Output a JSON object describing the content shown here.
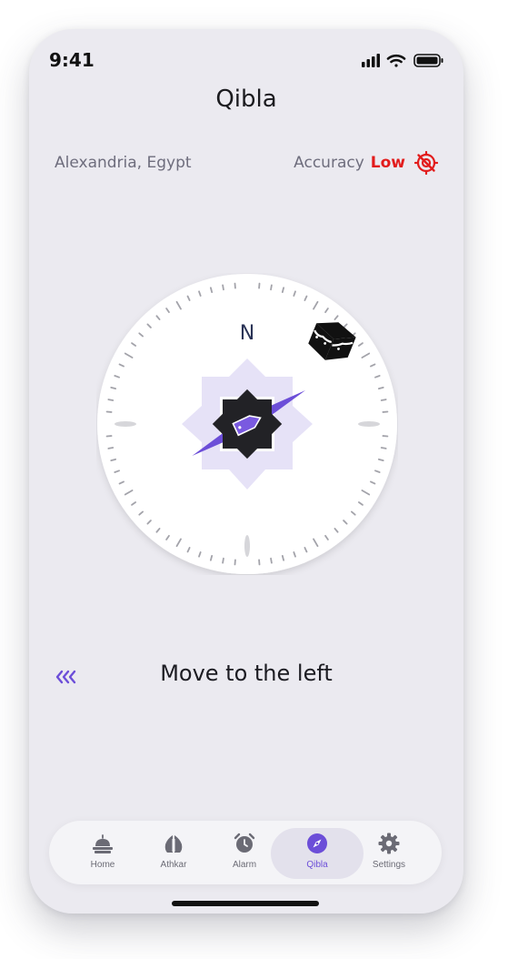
{
  "status": {
    "time": "9:41"
  },
  "header": {
    "title": "Qibla"
  },
  "info": {
    "location": "Alexandria, Egypt",
    "accuracy_label": "Accuracy",
    "accuracy_value": "Low"
  },
  "compass": {
    "north_label": "N"
  },
  "direction": {
    "message": "Move to the left"
  },
  "tabs": [
    {
      "label": "Home",
      "icon": "mosque-icon"
    },
    {
      "label": "Athkar",
      "icon": "hands-icon"
    },
    {
      "label": "Alarm",
      "icon": "alarm-clock-icon"
    },
    {
      "label": "Qibla",
      "icon": "compass-icon",
      "active": true
    },
    {
      "label": "Settings",
      "icon": "gear-icon"
    }
  ],
  "colors": {
    "accent": "#6c4ed8",
    "warning": "#e21c1c",
    "background": "#ebeaf0"
  }
}
